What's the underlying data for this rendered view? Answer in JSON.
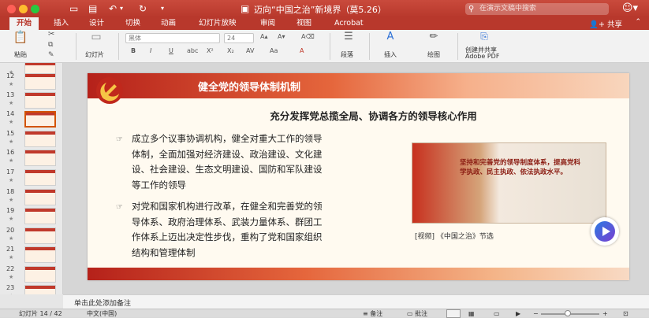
{
  "window": {
    "title": "迈向“中国之治”新境界（莫5.26）",
    "search_placeholder": "在演示文稿中搜索"
  },
  "tabs": [
    {
      "label": "开始",
      "active": true
    },
    {
      "label": "插入"
    },
    {
      "label": "设计"
    },
    {
      "label": "切换"
    },
    {
      "label": "动画"
    },
    {
      "label": "幻灯片放映"
    },
    {
      "label": "审阅"
    },
    {
      "label": "视图"
    },
    {
      "label": "Acrobat"
    }
  ],
  "share_label": "共享",
  "ribbon": {
    "paste": "粘贴",
    "slide": "幻灯片",
    "font_name": "黑体",
    "font_size": "24",
    "paragraph": "段落",
    "insert": "插入",
    "draw": "绘图",
    "create_pdf": "创建并共享",
    "create_pdf_2": "Adobe PDF"
  },
  "thumbnails": [
    {
      "num": "12"
    },
    {
      "num": "13"
    },
    {
      "num": "14",
      "selected": true
    },
    {
      "num": "15"
    },
    {
      "num": "16"
    },
    {
      "num": "17"
    },
    {
      "num": "18"
    },
    {
      "num": "19"
    },
    {
      "num": "20"
    },
    {
      "num": "21"
    },
    {
      "num": "22"
    },
    {
      "num": "23"
    }
  ],
  "slide": {
    "title": "健全党的领导体制机制",
    "subtitle": "充分发挥党总揽全局、协调各方的领导核心作用",
    "para1": [
      "成立多个议事协调机构，健全对重大工作的领导",
      "体制，全面加强对经济建设、政治建设、文化建",
      "设、社会建设、生态文明建设、国防和军队建设",
      "等工作的领导"
    ],
    "para2": [
      "对党和国家机构进行改革，在健全和完善党的领",
      "导体系、政府治理体系、武装力量体系、群团工",
      "作体系上迈出决定性步伐，重构了党和国家组织",
      "结构和管理体制"
    ],
    "video_text": "坚持和完善党的领导制度体系，提高党科学执政、民主执政、依法执政水平。",
    "video_caption": "[视频] 《中国之治》节选"
  },
  "notes_placeholder": "单击此处添加备注",
  "status": {
    "slide_pos": "幻灯片 14 / 42",
    "language": "中文(中国)",
    "notes": "备注",
    "comments": "批注"
  }
}
